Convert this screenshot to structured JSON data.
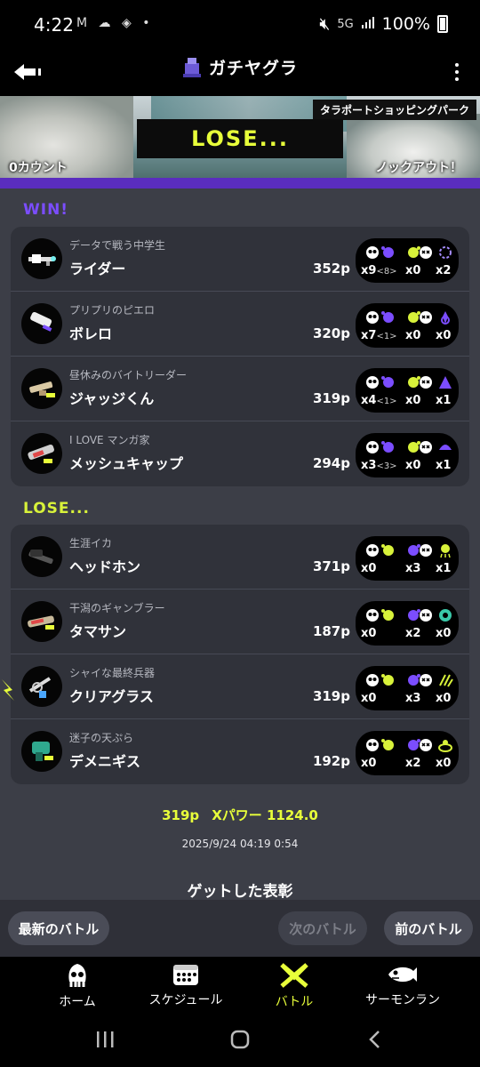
{
  "status_bar": {
    "time": "4:22",
    "left_icons": "M ☁ ◈ •",
    "network": "5G",
    "battery": "100%"
  },
  "header": {
    "title": "ガチヤグラ"
  },
  "banner": {
    "stage": "タラポートショッピングパーク",
    "result": "LOSE...",
    "left_count": "0カウント",
    "right_status": "ノックアウト！"
  },
  "teams": [
    {
      "label": "WIN!",
      "color": "#7b4dff",
      "players": [
        {
          "title": "データで戦う中学生",
          "name": "ライダー",
          "points": "352p",
          "kills": "x9",
          "assists": "<8>",
          "deaths": "x0",
          "specials": "x2"
        },
        {
          "title": "プリプリのピエロ",
          "name": "ボレロ",
          "points": "320p",
          "kills": "x7",
          "assists": "<1>",
          "deaths": "x0",
          "specials": "x0"
        },
        {
          "title": "昼休みのバイトリーダー",
          "name": "ジャッジくん",
          "points": "319p",
          "kills": "x4",
          "assists": "<1>",
          "deaths": "x0",
          "specials": "x1"
        },
        {
          "title": "I LOVE マンガ家",
          "name": "メッシュキャップ",
          "points": "294p",
          "kills": "x3",
          "assists": "<3>",
          "deaths": "x0",
          "specials": "x1"
        }
      ]
    },
    {
      "label": "LOSE...",
      "color": "#d8f23a",
      "players": [
        {
          "title": "生涯イカ",
          "name": "ヘッドホン",
          "points": "371p",
          "kills": "x0",
          "assists": "",
          "deaths": "x3",
          "specials": "x1"
        },
        {
          "title": "干潟のギャンブラー",
          "name": "タマサン",
          "points": "187p",
          "kills": "x0",
          "assists": "",
          "deaths": "x2",
          "specials": "x0"
        },
        {
          "title": "シャイな最終兵器",
          "name": "クリアグラス",
          "points": "319p",
          "kills": "x0",
          "assists": "",
          "deaths": "x3",
          "specials": "x0"
        },
        {
          "title": "迷子の天ぷら",
          "name": "デメニギス",
          "points": "192p",
          "kills": "x0",
          "assists": "",
          "deaths": "x2",
          "specials": "x0"
        }
      ]
    }
  ],
  "summary": {
    "points": "319p",
    "xpower": "Xパワー 1124.0",
    "datetime": "2025/9/24 04:19 0:54"
  },
  "awards_title": "ゲットした表彰",
  "battle_nav": {
    "latest": "最新のバトル",
    "next": "次のバトル",
    "prev": "前のバトル"
  },
  "tabs": {
    "home": "ホーム",
    "schedule": "スケジュール",
    "battle": "バトル",
    "salmon": "サーモンラン"
  },
  "colors": {
    "accent_yellow": "#e8ff3a",
    "purple": "#5a2dbe",
    "card_bg": "#30323a",
    "page_bg": "#3c3e47"
  },
  "icons": [
    "back-arrow-icon",
    "gachiyagura-icon",
    "more-vert-icon",
    "kill-icon",
    "death-icon",
    "special-icon",
    "home-icon",
    "schedule-icon",
    "battle-icon",
    "salmon-icon"
  ]
}
